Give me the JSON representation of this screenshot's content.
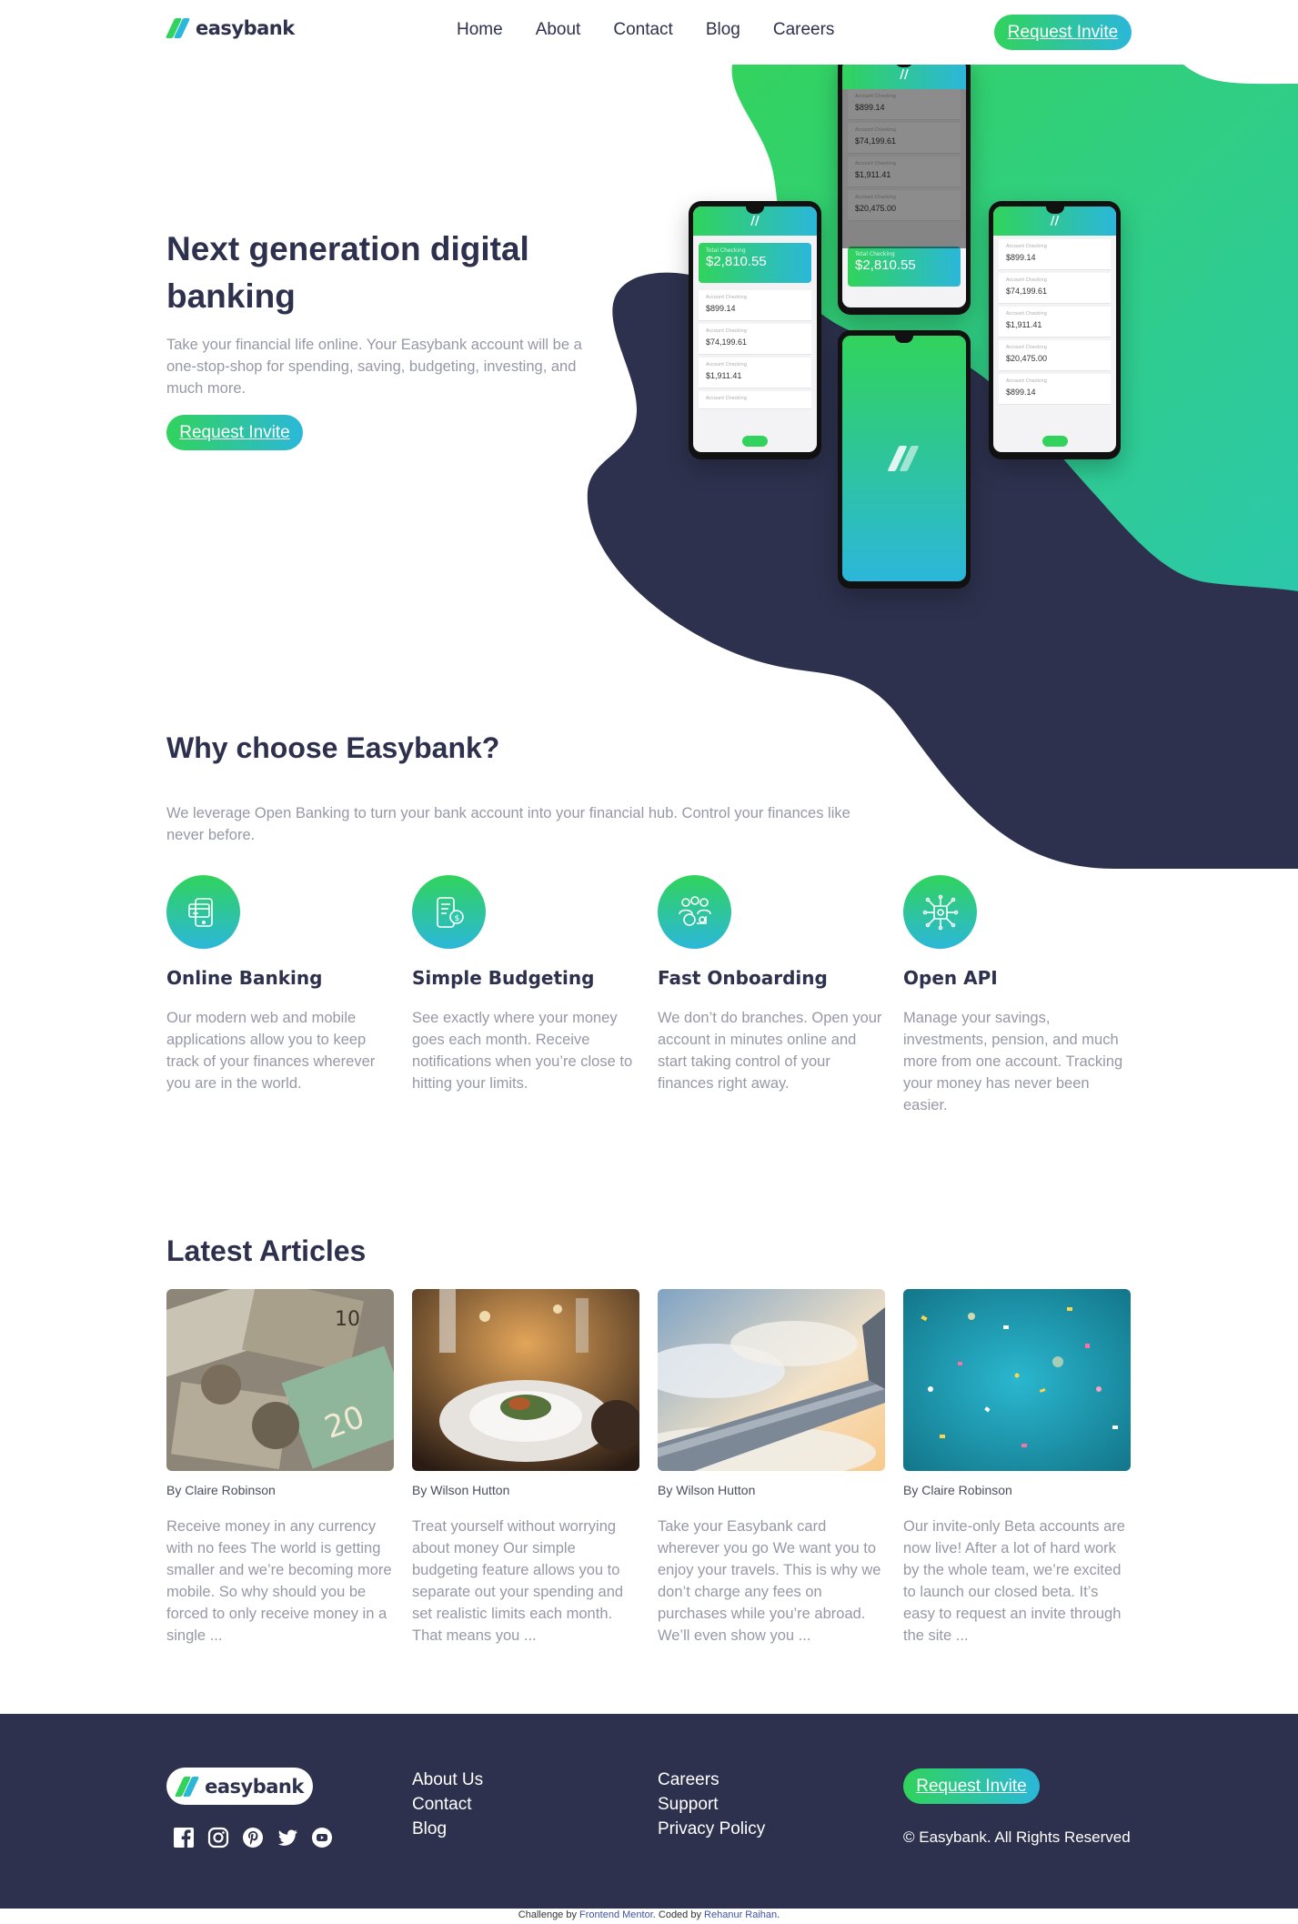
{
  "header": {
    "logo": "easybank",
    "nav": [
      "Home",
      "About",
      "Contact",
      "Blog",
      "Careers"
    ],
    "cta": "Request Invite"
  },
  "hero": {
    "title": "Next generation digital banking",
    "text": "Take your financial life online. Your Easybank account will be a one-stop-shop for spending, saving, budgeting, investing, and much more.",
    "cta": "Request Invite",
    "phone": {
      "total_label": "Total Checking",
      "total": "$2,810.55",
      "account_label": "Account Checking",
      "balances": [
        "$899.14",
        "$74,199.61",
        "$1,911.41",
        "$20,475.00",
        "$899.14"
      ]
    }
  },
  "why": {
    "title": "Why choose Easybank?",
    "text": "We leverage Open Banking to turn your bank account into your financial hub. Control your finances like never before.",
    "features": [
      {
        "title": "Online Banking",
        "text": "Our modern web and mobile applications allow you to keep track of your finances wherever you are in the world.",
        "icon": "card-phone-icon"
      },
      {
        "title": "Simple Budgeting",
        "text": "See exactly where your money goes each month. Receive notifications when you’re close to hitting your limits.",
        "icon": "budget-phone-icon"
      },
      {
        "title": "Fast Onboarding",
        "text": "We don’t do branches. Open your account in minutes online and start taking control of your finances right away.",
        "icon": "onboarding-people-icon"
      },
      {
        "title": "Open API",
        "text": "Manage your savings, investments, pension, and much more from one account. Tracking your money has never been easier.",
        "icon": "api-chip-icon"
      }
    ]
  },
  "articles": {
    "title": "Latest Articles",
    "items": [
      {
        "author": "By Claire Robinson",
        "excerpt": "Receive money in any currency with no fees The world is getting smaller and we’re becoming more mobile. So why should you be forced to only receive money in a single ..."
      },
      {
        "author": "By Wilson Hutton",
        "excerpt": "Treat yourself without worrying about money Our simple budgeting feature allows you to separate out your spending and set realistic limits each month. That means you ..."
      },
      {
        "author": "By Wilson Hutton",
        "excerpt": "Take your Easybank card wherever you go We want you to enjoy your travels. This is why we don’t charge any fees on purchases while you’re abroad. We’ll even show you ..."
      },
      {
        "author": "By Claire Robinson",
        "excerpt": "Our invite-only Beta accounts are now live! After a lot of hard work by the whole team, we’re excited to launch our closed beta. It’s easy to request an invite through the site ..."
      }
    ]
  },
  "footer": {
    "logo": "easybank",
    "socials": [
      "facebook-icon",
      "instagram-icon",
      "pinterest-icon",
      "twitter-icon",
      "youtube-icon"
    ],
    "col1": [
      "About Us",
      "Contact",
      "Blog"
    ],
    "col2": [
      "Careers",
      "Support",
      "Privacy Policy"
    ],
    "cta": "Request Invite",
    "copyright": "© Easybank. All Rights Reserved"
  },
  "attribution": {
    "prefix": "Challenge by ",
    "link1": "Frontend Mentor",
    "middle": ". Coded by ",
    "link2": "Rehanur Raihan",
    "suffix": "."
  },
  "colors": {
    "dark_blue": "#2d314d",
    "lime_green": "#31d35c",
    "bright_cyan": "#2bb7da",
    "grayish_blue": "#9698a6"
  }
}
